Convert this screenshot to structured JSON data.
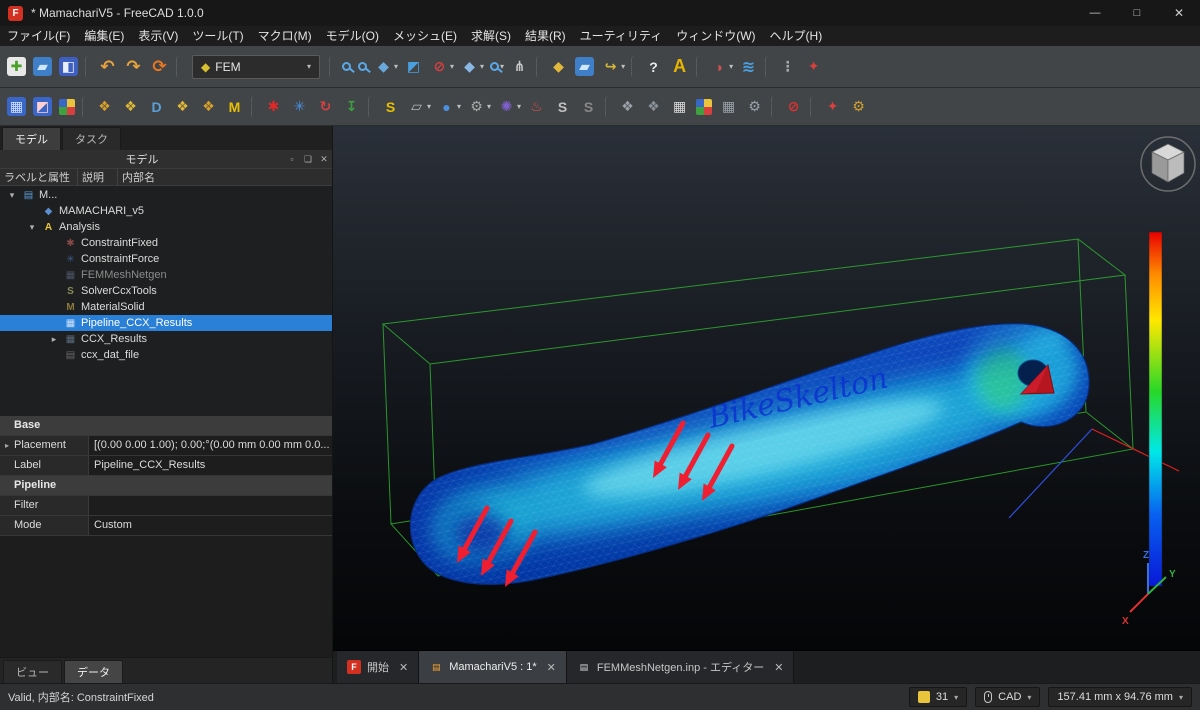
{
  "window": {
    "title": "* MamachariV5 - FreeCAD 1.0.0",
    "app_icon": "F",
    "controls": {
      "minimize": "—",
      "maximize": "□",
      "close": "✕"
    }
  },
  "menu": [
    "ファイル(F)",
    "編集(E)",
    "表示(V)",
    "ツール(T)",
    "マクロ(M)",
    "モデル(O)",
    "メッシュ(E)",
    "求解(S)",
    "結果(R)",
    "ユーティリティ",
    "ウィンドウ(W)",
    "ヘルプ(H)"
  ],
  "toolbars": {
    "workbench_label": "FEM",
    "workbench_icon": "◆",
    "caret": "▾",
    "row1_left": [
      {
        "name": "new-document-button",
        "glyph": "✚",
        "color": "#4aa028",
        "bg": "#e8e8e8"
      },
      {
        "name": "open-document-button",
        "glyph": "▰",
        "color": "#cfe6ff",
        "bg": "#3f7fc8"
      },
      {
        "name": "save-document-button",
        "glyph": "◧",
        "color": "#e8eeff",
        "bg": "#3f5fc0"
      },
      {
        "name": "toolbar-separator",
        "cls": "sep"
      },
      {
        "name": "undo-button",
        "glyph": "↶",
        "color": "#e8a33c",
        "size": "17px"
      },
      {
        "name": "redo-button",
        "glyph": "↷",
        "color": "#e8a33c",
        "size": "17px"
      },
      {
        "name": "refresh-button",
        "glyph": "⟳",
        "color": "#e87820",
        "size": "17px"
      },
      {
        "name": "toolbar-separator",
        "cls": "sep"
      }
    ],
    "row1_right": [
      {
        "name": "toolbar-separator",
        "cls": "sep"
      },
      {
        "name": "fit-all-button",
        "cls": "mag"
      },
      {
        "name": "box-zoom-button",
        "cls": "mag"
      },
      {
        "name": "view-cube-button",
        "glyph": "◆",
        "color": "#6aa8dc",
        "dd": "▾"
      },
      {
        "name": "sync-view-button",
        "glyph": "◩",
        "color": "#4a9fe0"
      },
      {
        "name": "clip-plane-button",
        "glyph": "⊘",
        "color": "#d84040",
        "dd": "▾"
      },
      {
        "name": "axonometric-view-button",
        "glyph": "◆",
        "color": "#8ab8e4",
        "dd": "▾"
      },
      {
        "name": "zoom-tools-button",
        "cls": "mag",
        "dd": "▾"
      },
      {
        "name": "measure-button",
        "glyph": "⋔",
        "color": "#c8c8c8"
      },
      {
        "name": "toolbar-separator",
        "cls": "sep"
      },
      {
        "name": "part-box-button",
        "glyph": "◆",
        "color": "#e2b93c"
      },
      {
        "name": "group-button",
        "glyph": "▰",
        "color": "#cfe6ff",
        "bg": "#3f7fc8"
      },
      {
        "name": "link-button",
        "glyph": "↪",
        "color": "#d8b838",
        "dd": "▾"
      },
      {
        "name": "toolbar-separator",
        "cls": "sep"
      },
      {
        "name": "whats-this-button",
        "glyph": "?",
        "color": "#eaeaea"
      },
      {
        "name": "text-annotation-button",
        "glyph": "A",
        "color": "#e8b400",
        "size": "18px"
      },
      {
        "name": "toolbar-separator",
        "cls": "sep"
      },
      {
        "name": "appearance-button",
        "glyph": "◑",
        "color": "#d05050",
        "dd": "▾"
      },
      {
        "name": "random-color-button",
        "glyph": "≋",
        "color": "#4aa0e0",
        "size": "16px"
      },
      {
        "name": "toolbar-separator",
        "cls": "sep"
      },
      {
        "name": "overflow-handle-button",
        "glyph": "⋮",
        "color": "#aaaaaa"
      },
      {
        "name": "addon-tool-button",
        "glyph": "✦",
        "color": "#d84040"
      }
    ],
    "row2": [
      {
        "name": "fem-mesh-button",
        "glyph": "▦",
        "color": "#cfe0ff",
        "bg": "#3a66c8"
      },
      {
        "name": "fem-mesh-region-button",
        "glyph": "◩",
        "color": "#ffd0d0",
        "bg": "#3a66c8"
      },
      {
        "name": "fem-mesh-groups-button",
        "cls": "rubik"
      },
      {
        "name": "toolbar-separator",
        "cls": "sep"
      },
      {
        "name": "analysis-container-button",
        "glyph": "❖",
        "color": "#d8a028"
      },
      {
        "name": "mesh-boundary-layer-button",
        "glyph": "❖",
        "color": "#e0b838"
      },
      {
        "name": "model-body-button",
        "glyph": "D",
        "color": "#5a9fd8"
      },
      {
        "name": "element-geometry-button",
        "glyph": "❖",
        "color": "#e0b838"
      },
      {
        "name": "element-fluid-button",
        "glyph": "❖",
        "color": "#d8a028"
      },
      {
        "name": "material-solid-button",
        "glyph": "M",
        "color": "#e8c000"
      },
      {
        "name": "toolbar-separator",
        "cls": "sep"
      },
      {
        "name": "constraint-fixed-button",
        "glyph": "✱",
        "color": "#e02828"
      },
      {
        "name": "constraint-force-button",
        "glyph": "✳",
        "color": "#4a90e0"
      },
      {
        "name": "constraint-bearing-button",
        "glyph": "↻",
        "color": "#d84040"
      },
      {
        "name": "constraint-displacement-button",
        "glyph": "↧",
        "color": "#3aa040"
      },
      {
        "name": "toolbar-separator",
        "cls": "sep"
      },
      {
        "name": "solver-button",
        "glyph": "S",
        "color": "#e8c000"
      },
      {
        "name": "constraint-plane-rotation-button",
        "glyph": "▱",
        "color": "#b8b8b8",
        "dd": "▾"
      },
      {
        "name": "constraint-contact-button",
        "glyph": "●",
        "color": "#4a90e0",
        "dd": "▾"
      },
      {
        "name": "constraint-transform-button",
        "glyph": "⚙",
        "color": "#a8a8a8",
        "dd": "▾"
      },
      {
        "name": "constraint-spring-button",
        "glyph": "✺",
        "color": "#8060d0",
        "dd": "▾"
      },
      {
        "name": "constraint-temperature-button",
        "glyph": "♨",
        "color": "#d85050"
      },
      {
        "name": "solver-ccx-button",
        "glyph": "S",
        "color": "#c0c0c0"
      },
      {
        "name": "solver-stop-button",
        "glyph": "S",
        "color": "#888888"
      },
      {
        "name": "toolbar-separator",
        "cls": "sep"
      },
      {
        "name": "result-mesh-button",
        "glyph": "❖",
        "color": "#9aa0a8"
      },
      {
        "name": "result-show-button",
        "glyph": "❖",
        "color": "#8a9098"
      },
      {
        "name": "result-table-button",
        "glyph": "▦",
        "color": "#d8d8d8"
      },
      {
        "name": "result-groups-button",
        "cls": "rubik"
      },
      {
        "name": "result-filter-button",
        "glyph": "▦",
        "color": "#98a0a8"
      },
      {
        "name": "result-settings-button",
        "glyph": "⚙",
        "color": "#98a0a8"
      },
      {
        "name": "toolbar-separator",
        "cls": "sep"
      },
      {
        "name": "purge-results-button",
        "glyph": "⊘",
        "color": "#e03030"
      },
      {
        "name": "toolbar-separator",
        "cls": "sep"
      },
      {
        "name": "extra-tool-button",
        "glyph": "✦",
        "color": "#d84040"
      },
      {
        "name": "extra-gear-button",
        "glyph": "⚙",
        "color": "#d0a030"
      }
    ]
  },
  "left_panel": {
    "tabs": [
      {
        "name": "tab-model",
        "label": "モデル",
        "cls": "active"
      },
      {
        "name": "tab-tasks",
        "label": "タスク"
      }
    ],
    "title": "モデル",
    "window_icons": [
      {
        "name": "panel-float-icon",
        "glyph": "▫"
      },
      {
        "name": "panel-restore-icon",
        "glyph": "❏"
      },
      {
        "name": "panel-close-icon",
        "glyph": "✕"
      }
    ],
    "columns": {
      "c1": "ラベルと属性",
      "c2": "説明",
      "c3": "内部名"
    },
    "tree": [
      {
        "name": "tree-item-document",
        "pad": "4px",
        "exp": "▾",
        "icon": "▤",
        "iconColor": "#5a9fd8",
        "label": "M..."
      },
      {
        "name": "tree-item-part",
        "pad": "24px",
        "exp": "",
        "icon": "◆",
        "iconColor": "#5a8fd0",
        "label": "MAMACHARI_v5"
      },
      {
        "name": "tree-item-analysis",
        "pad": "24px",
        "exp": "▾",
        "icon": "A",
        "iconColor": "#e8c53a",
        "label": "Analysis"
      },
      {
        "name": "tree-item-constraint-fixed",
        "pad": "46px",
        "exp": "",
        "icon": "✱",
        "iconColor": "#8a4a4a",
        "label": "ConstraintFixed"
      },
      {
        "name": "tree-item-constraint-force",
        "pad": "46px",
        "exp": "",
        "icon": "✳",
        "iconColor": "#3a5a8a",
        "label": "ConstraintForce"
      },
      {
        "name": "tree-item-fem-mesh",
        "pad": "46px",
        "exp": "",
        "icon": "▦",
        "iconColor": "#4a5568",
        "label": "FEMMeshNetgen",
        "cls": "muted"
      },
      {
        "name": "tree-item-solver",
        "pad": "46px",
        "exp": "",
        "icon": "S",
        "iconColor": "#8a8a5a",
        "label": "SolverCcxTools"
      },
      {
        "name": "tree-item-material",
        "pad": "46px",
        "exp": "",
        "icon": "M",
        "iconColor": "#8a7a3a",
        "label": "MaterialSolid"
      },
      {
        "name": "tree-item-pipeline",
        "pad": "46px",
        "exp": "",
        "icon": "▦",
        "iconColor": "#cfe4ff",
        "label": "Pipeline_CCX_Results",
        "cls": "sel"
      },
      {
        "name": "tree-item-ccx-results",
        "pad": "46px",
        "exp": "▸",
        "icon": "▦",
        "iconColor": "#5a6a7a",
        "label": "CCX_Results"
      },
      {
        "name": "tree-item-dat-file",
        "pad": "46px",
        "exp": "",
        "icon": "▤",
        "iconColor": "#6a6a6a",
        "label": "ccx_dat_file"
      }
    ],
    "properties": [
      {
        "name": "property-group-base",
        "cls": "grp",
        "exp": "",
        "label": "Base",
        "value": ""
      },
      {
        "name": "property-placement",
        "exp": "▸",
        "label": "Placement",
        "value": "[(0.00 0.00 1.00); 0.00;°(0.00 mm 0.00 mm 0.0..."
      },
      {
        "name": "property-label",
        "exp": "",
        "label": "Label",
        "value": "Pipeline_CCX_Results"
      },
      {
        "name": "property-group-pipeline",
        "cls": "grp",
        "exp": "",
        "label": "Pipeline",
        "value": ""
      },
      {
        "name": "property-filter",
        "exp": "",
        "label": "Filter",
        "value": ""
      },
      {
        "name": "property-mode",
        "exp": "",
        "label": "Mode",
        "value": "Custom"
      }
    ],
    "bottom_tabs": [
      {
        "name": "tab-view",
        "label": "ビュー"
      },
      {
        "name": "tab-data",
        "label": "データ",
        "cls": "active"
      }
    ]
  },
  "viewport": {
    "model_text": "BikeSkelton",
    "axes": {
      "x": "X",
      "y": "Y",
      "z": "Z"
    },
    "legend_colors": [
      "#e80000",
      "#ff8c00",
      "#ffe800",
      "#28d828",
      "#00e8e8",
      "#0860f0",
      "#0818d8"
    ]
  },
  "doc_tabs": [
    {
      "name": "doc-tab-start",
      "icon": "F",
      "iconColor": "#ffffff",
      "iconBg": "#d23020",
      "label": "開始",
      "close": "✕"
    },
    {
      "name": "doc-tab-model",
      "cls": "active",
      "icon": "▤",
      "iconColor": "#f0a030",
      "iconBg": "transparent",
      "label": "MamachariV5 : 1*",
      "close": "✕"
    },
    {
      "name": "doc-tab-editor",
      "icon": "▤",
      "iconColor": "#d8d8d8",
      "iconBg": "transparent",
      "label": "FEMMeshNetgen.inp - エディター",
      "close": "✕"
    }
  ],
  "statusbar": {
    "message": "Valid, 内部名: ConstraintFixed",
    "zoom": "31",
    "nav_style": "CAD",
    "dimensions": "157.41 mm x 94.76 mm",
    "caret": "▾"
  },
  "colors": {
    "selection": "#2a7fd6",
    "wireframe": "#2fae2f",
    "force_arrow": "#ef1e30"
  }
}
